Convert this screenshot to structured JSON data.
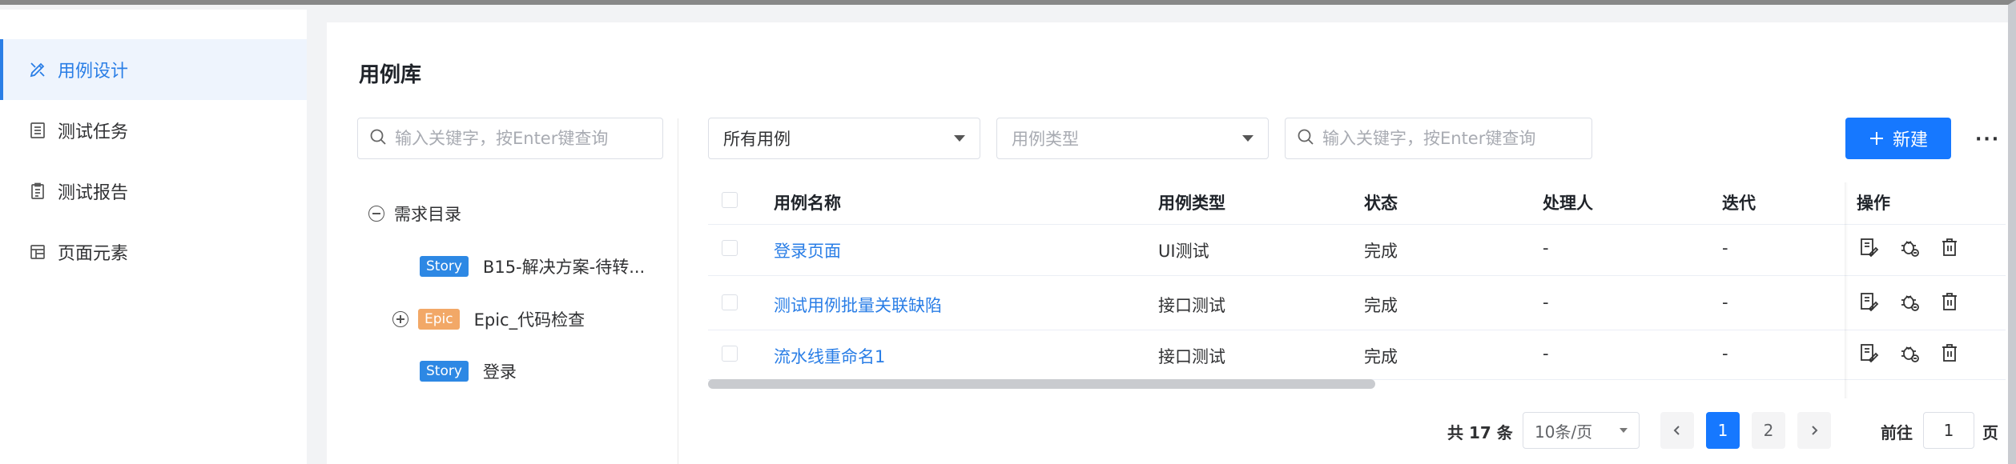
{
  "sidebar": {
    "items": [
      {
        "label": "用例设计",
        "icon": "edit-tools-icon",
        "active": true
      },
      {
        "label": "测试任务",
        "icon": "document-list-icon",
        "active": false
      },
      {
        "label": "测试报告",
        "icon": "clipboard-icon",
        "active": false
      },
      {
        "label": "页面元素",
        "icon": "table-grid-icon",
        "active": false
      }
    ]
  },
  "main": {
    "title": "用例库",
    "tree_search_placeholder": "输入关键字，按Enter键查询",
    "tree": {
      "root": "需求目录",
      "nodes": [
        {
          "tag": "Story",
          "label": "B15-解决方案-待转..."
        },
        {
          "tag": "Epic",
          "label": "Epic_代码检查"
        },
        {
          "tag": "Story",
          "label": "登录"
        }
      ]
    },
    "filters": {
      "scope": "所有用例",
      "type_placeholder": "用例类型",
      "search_placeholder": "输入关键字，按Enter键查询"
    },
    "new_button": "新建",
    "more": "···",
    "table": {
      "headers": [
        "用例名称",
        "用例类型",
        "状态",
        "处理人",
        "迭代",
        "操作"
      ],
      "rows": [
        {
          "name": "登录页面",
          "type": "UI测试",
          "status": "完成",
          "owner": "-",
          "iteration": "-"
        },
        {
          "name": "测试用例批量关联缺陷",
          "type": "接口测试",
          "status": "完成",
          "owner": "-",
          "iteration": "-"
        },
        {
          "name": "流水线重命名1",
          "type": "接口测试",
          "status": "完成",
          "owner": "-",
          "iteration": "-"
        }
      ]
    },
    "pagination": {
      "total": "共 17 条",
      "page_size": "10条/页",
      "pages": [
        "1",
        "2"
      ],
      "current": "1",
      "goto_prefix": "前往",
      "goto_value": "1",
      "goto_suffix": "页"
    }
  },
  "colors": {
    "accent": "#1678ff",
    "link": "#2a7ee6",
    "story_tag": "#2d88e4",
    "epic_tag": "#f2a867"
  }
}
